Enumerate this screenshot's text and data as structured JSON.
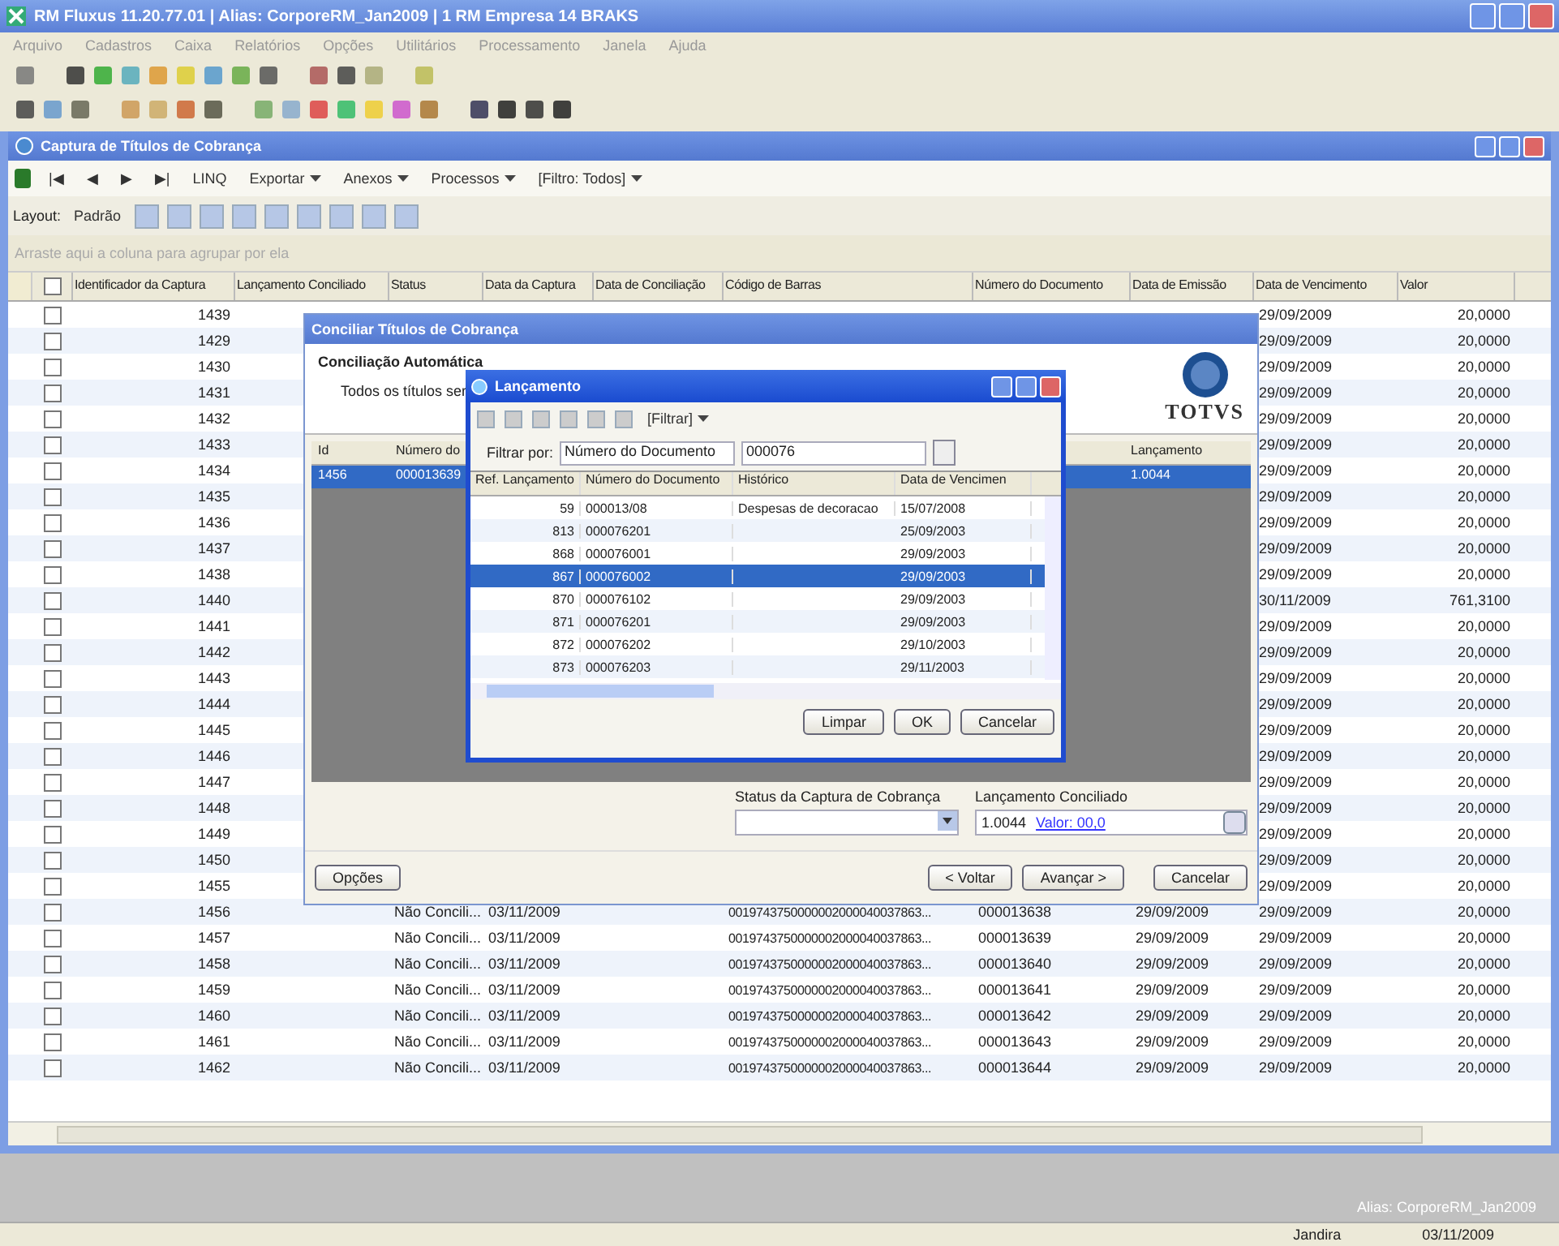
{
  "window": {
    "title": "RM Fluxus 11.20.77.01 | Alias: CorporeRM_Jan2009 | 1 RM Empresa 14 BRAKS"
  },
  "menu": [
    "Arquivo",
    "Cadastros",
    "Caixa",
    "Relatórios",
    "Opções",
    "Utilitários",
    "Processamento",
    "Janela",
    "Ajuda"
  ],
  "mdi": {
    "title": "Captura de Títulos de Cobrança",
    "toolbar": [
      {
        "kind": "nav",
        "label": "|◀"
      },
      {
        "kind": "nav",
        "label": "◀"
      },
      {
        "kind": "nav",
        "label": "▶"
      },
      {
        "kind": "nav",
        "label": "▶|"
      },
      {
        "kind": "text",
        "label": "LINQ"
      },
      {
        "kind": "menu",
        "label": "Exportar"
      },
      {
        "kind": "menu",
        "label": "Anexos"
      },
      {
        "kind": "menu",
        "label": "Processos"
      },
      {
        "kind": "menu",
        "label": "[Filtro: Todos]"
      }
    ],
    "layout_label": "Layout:",
    "layout_value": "Padrão",
    "group_hint": "Arraste aqui a coluna para agrupar por ela",
    "all_checked": false,
    "columns": [
      "Identificador da Captura",
      "Lançamento Conciliado",
      "Status",
      "Data da Captura",
      "Data de Conciliação",
      "Código de Barras",
      "Número do Documento",
      "Data de Emissão",
      "Data de Vencimento",
      "Valor"
    ],
    "rows": [
      {
        "checked": false,
        "id": "1439",
        "vencimento": "29/09/2009",
        "valor": "20,0000"
      },
      {
        "checked": false,
        "id": "1429",
        "vencimento": "29/09/2009",
        "valor": "20,0000"
      },
      {
        "checked": false,
        "id": "1430",
        "vencimento": "29/09/2009",
        "valor": "20,0000"
      },
      {
        "checked": false,
        "id": "1431",
        "vencimento": "29/09/2009",
        "valor": "20,0000"
      },
      {
        "checked": false,
        "id": "1432",
        "vencimento": "29/09/2009",
        "valor": "20,0000"
      },
      {
        "checked": false,
        "id": "1433",
        "vencimento": "29/09/2009",
        "valor": "20,0000"
      },
      {
        "checked": false,
        "id": "1434",
        "vencimento": "29/09/2009",
        "valor": "20,0000"
      },
      {
        "checked": false,
        "id": "1435",
        "vencimento": "29/09/2009",
        "valor": "20,0000"
      },
      {
        "checked": false,
        "id": "1436",
        "vencimento": "29/09/2009",
        "valor": "20,0000"
      },
      {
        "checked": false,
        "id": "1437",
        "vencimento": "29/09/2009",
        "valor": "20,0000"
      },
      {
        "checked": false,
        "id": "1438",
        "vencimento": "29/09/2009",
        "valor": "20,0000"
      },
      {
        "checked": false,
        "id": "1440",
        "vencimento": "30/11/2009",
        "valor": "761,3100"
      },
      {
        "checked": false,
        "id": "1441",
        "vencimento": "29/09/2009",
        "valor": "20,0000"
      },
      {
        "checked": false,
        "id": "1442",
        "vencimento": "29/09/2009",
        "valor": "20,0000"
      },
      {
        "checked": false,
        "id": "1443",
        "vencimento": "29/09/2009",
        "valor": "20,0000"
      },
      {
        "checked": false,
        "id": "1444",
        "vencimento": "29/09/2009",
        "valor": "20,0000"
      },
      {
        "checked": false,
        "id": "1445",
        "vencimento": "29/09/2009",
        "valor": "20,0000"
      },
      {
        "checked": false,
        "id": "1446",
        "vencimento": "29/09/2009",
        "valor": "20,0000"
      },
      {
        "checked": false,
        "id": "1447",
        "vencimento": "29/09/2009",
        "valor": "20,0000"
      },
      {
        "checked": false,
        "id": "1448",
        "vencimento": "29/09/2009",
        "valor": "20,0000"
      },
      {
        "checked": false,
        "id": "1449",
        "vencimento": "29/09/2009",
        "valor": "20,0000"
      },
      {
        "checked": false,
        "id": "1450",
        "vencimento": "29/09/2009",
        "valor": "20,0000"
      },
      {
        "checked": false,
        "id": "1455",
        "vencimento": "29/09/2009",
        "valor": "20,0000"
      },
      {
        "checked": false,
        "id": "1456",
        "status": "Não Concili...",
        "captura": "03/11/2009",
        "barras": "0019743750000002000040037863...",
        "documento": "000013638",
        "emissao": "29/09/2009",
        "vencimento": "29/09/2009",
        "valor": "20,0000"
      },
      {
        "checked": false,
        "id": "1457",
        "status": "Não Concili...",
        "captura": "03/11/2009",
        "barras": "0019743750000002000040037863...",
        "documento": "000013639",
        "emissao": "29/09/2009",
        "vencimento": "29/09/2009",
        "valor": "20,0000"
      },
      {
        "checked": false,
        "id": "1458",
        "status": "Não Concili...",
        "captura": "03/11/2009",
        "barras": "0019743750000002000040037863...",
        "documento": "000013640",
        "emissao": "29/09/2009",
        "vencimento": "29/09/2009",
        "valor": "20,0000"
      },
      {
        "checked": false,
        "id": "1459",
        "status": "Não Concili...",
        "captura": "03/11/2009",
        "barras": "0019743750000002000040037863...",
        "documento": "000013641",
        "emissao": "29/09/2009",
        "vencimento": "29/09/2009",
        "valor": "20,0000"
      },
      {
        "checked": false,
        "id": "1460",
        "status": "Não Concili...",
        "captura": "03/11/2009",
        "barras": "0019743750000002000040037863...",
        "documento": "000013642",
        "emissao": "29/09/2009",
        "vencimento": "29/09/2009",
        "valor": "20,0000"
      },
      {
        "checked": false,
        "id": "1461",
        "status": "Não Concili...",
        "captura": "03/11/2009",
        "barras": "0019743750000002000040037863...",
        "documento": "000013643",
        "emissao": "29/09/2009",
        "vencimento": "29/09/2009",
        "valor": "20,0000"
      },
      {
        "checked": false,
        "id": "1462",
        "status": "Não Concili...",
        "captura": "03/11/2009",
        "barras": "0019743750000002000040037863...",
        "documento": "000013644",
        "emissao": "29/09/2009",
        "vencimento": "29/09/2009",
        "valor": "20,0000"
      }
    ]
  },
  "wizard": {
    "title": "Conciliar Títulos de Cobrança",
    "heading": "Conciliação Automática",
    "subtitle": "Todos os títulos ser",
    "logo": "TOTVS",
    "columns": [
      "Id",
      "Número do",
      "Lançamento"
    ],
    "row": {
      "selected": true,
      "id": "1456",
      "documento": "000013639",
      "lancamento": "1.0044"
    },
    "status_label": "Status da Captura de Cobrança",
    "lanc_label": "Lançamento Conciliado",
    "lanc_value": "1.0044",
    "lanc_link": "Valor: 00,0",
    "left_button": "Opções",
    "buttons": [
      "< Voltar",
      "Avançar >",
      "Cancelar"
    ]
  },
  "lookup": {
    "title": "Lançamento",
    "filter_menu": "[Filtrar]",
    "filter_label": "Filtrar por:",
    "filter_field": "Número do Documento",
    "filter_value": "000076",
    "columns": [
      "Ref. Lançamento",
      "Número do Documento",
      "Histórico",
      "Data de Vencimen"
    ],
    "rows": [
      {
        "selected": false,
        "ref": "59",
        "documento": "000013/08",
        "historico": "Despesas de decoracao",
        "vencimento": "15/07/2008"
      },
      {
        "selected": false,
        "ref": "813",
        "documento": "000076201",
        "vencimento": "25/09/2003"
      },
      {
        "selected": false,
        "ref": "868",
        "documento": "000076001",
        "vencimento": "29/09/2003"
      },
      {
        "selected": true,
        "ref": "867",
        "documento": "000076002",
        "vencimento": "29/09/2003"
      },
      {
        "selected": false,
        "ref": "870",
        "documento": "000076102",
        "vencimento": "29/09/2003"
      },
      {
        "selected": false,
        "ref": "871",
        "documento": "000076201",
        "vencimento": "29/09/2003"
      },
      {
        "selected": false,
        "ref": "872",
        "documento": "000076202",
        "vencimento": "29/10/2003"
      },
      {
        "selected": false,
        "ref": "873",
        "documento": "000076203",
        "vencimento": "29/11/2003"
      }
    ],
    "buttons": [
      "Limpar",
      "OK",
      "Cancelar"
    ]
  },
  "workspace_alias": "Alias: CorporeRM_Jan2009",
  "status_bar": [
    "Jandira",
    "03/11/2009"
  ]
}
